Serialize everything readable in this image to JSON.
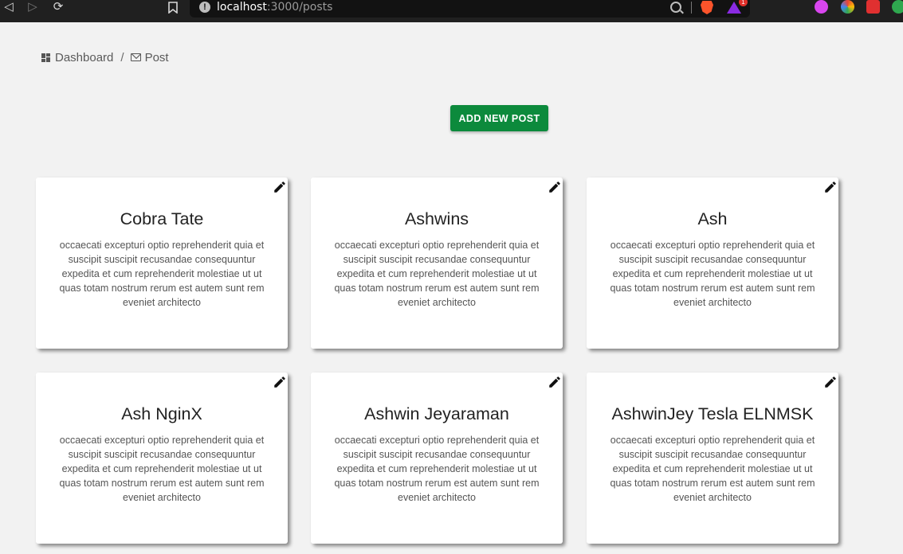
{
  "browser": {
    "url_host": "localhost",
    "url_path": ":3000/posts",
    "rewards_badge": "1"
  },
  "breadcrumb": {
    "items": [
      {
        "label": "Dashboard",
        "icon": "dashboard-icon"
      },
      {
        "label": "Post",
        "icon": "mail-icon"
      }
    ],
    "separator": "/"
  },
  "actions": {
    "add_post_label": "ADD NEW POST",
    "accent_color": "#0c8a3c"
  },
  "posts": [
    {
      "title": "Cobra Tate",
      "body": "occaecati excepturi optio reprehenderit quia et suscipit suscipit recusandae consequuntur expedita et cum reprehenderit molestiae ut ut quas totam nostrum rerum est autem sunt rem eveniet architecto"
    },
    {
      "title": "Ashwins",
      "body": "occaecati excepturi optio reprehenderit quia et suscipit suscipit recusandae consequuntur expedita et cum reprehenderit molestiae ut ut quas totam nostrum rerum est autem sunt rem eveniet architecto"
    },
    {
      "title": "Ash",
      "body": "occaecati excepturi optio reprehenderit quia et suscipit suscipit recusandae consequuntur expedita et cum reprehenderit molestiae ut ut quas totam nostrum rerum est autem sunt rem eveniet architecto"
    },
    {
      "title": "Ash NginX",
      "body": "occaecati excepturi optio reprehenderit quia et suscipit suscipit recusandae consequuntur expedita et cum reprehenderit molestiae ut ut quas totam nostrum rerum est autem sunt rem eveniet architecto"
    },
    {
      "title": "Ashwin Jeyaraman",
      "body": "occaecati excepturi optio reprehenderit quia et suscipit suscipit recusandae consequuntur expedita et cum reprehenderit molestiae ut ut quas totam nostrum rerum est autem sunt rem eveniet architecto"
    },
    {
      "title": "AshwinJey Tesla ELNMSK",
      "body": "occaecati excepturi optio reprehenderit quia et suscipit suscipit recusandae consequuntur expedita et cum reprehenderit molestiae ut ut quas totam nostrum rerum est autem sunt rem eveniet architecto"
    }
  ]
}
